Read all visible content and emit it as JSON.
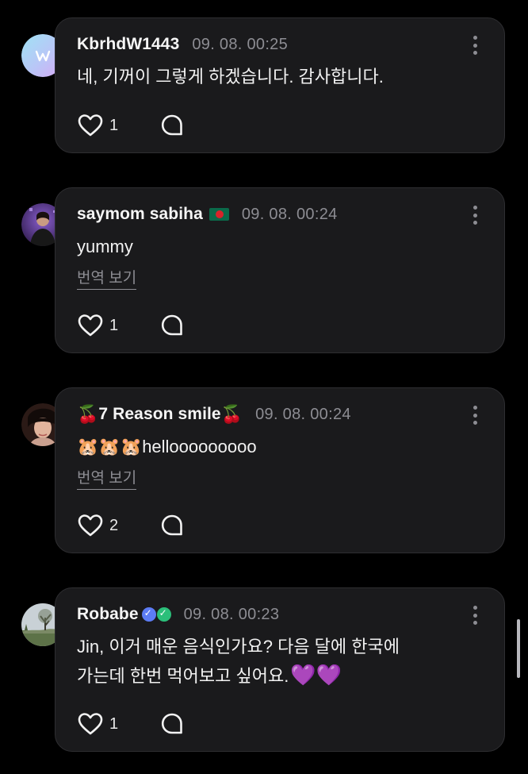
{
  "comments": [
    {
      "author": "KbrhdW1443",
      "timestamp": "09. 08. 00:25",
      "text": "네, 기꺼이 그렇게 하겠습니다. 감사합니다.",
      "likes": "1",
      "avatar_icon": "weverse-logo-avatar"
    },
    {
      "author": "saymom sabiha",
      "author_flag": "bangladesh-flag",
      "timestamp": "09. 08. 00:24",
      "text": "yummy",
      "translate_label": "번역 보기",
      "likes": "1",
      "avatar_icon": "user-photo-avatar"
    },
    {
      "author_prefix_emoji": "🍒",
      "author": "7 Reason smile",
      "author_suffix_emoji": "🍒",
      "timestamp": "09. 08. 00:24",
      "text_emoji": "🐹🐹🐹",
      "text": "hellooooooooo",
      "translate_label": "번역 보기",
      "likes": "2",
      "avatar_icon": "user-photo-avatar"
    },
    {
      "author": "Robabe",
      "author_badges": [
        "verified-badge-blue",
        "verified-badge-green"
      ],
      "timestamp": "09. 08. 00:23",
      "text_line1": "Jin, 이거 매운 음식인가요? 다음 달에 한국에",
      "text_line2": "가는데 한번 먹어보고 싶어요.",
      "text_emoji": "💜💜",
      "likes": "1",
      "avatar_icon": "landscape-photo-avatar"
    }
  ],
  "icons": {
    "like": "heart-outline-icon",
    "reply": "speech-bubble-icon",
    "more": "vertical-ellipsis-icon"
  },
  "colors": {
    "background": "#000000",
    "card": "#1a1a1c",
    "muted_text": "#8d8d93",
    "accent_purple": "#9b3ee0"
  }
}
